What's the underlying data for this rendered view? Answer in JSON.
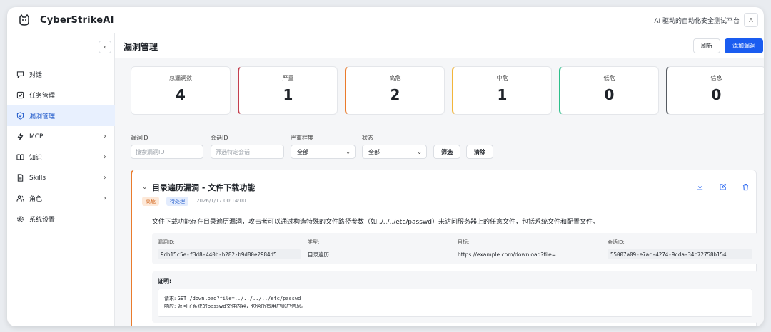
{
  "app": {
    "brand": "CyberStrikeAI",
    "tagline": "AI 驱动的自动化安全测试平台",
    "user_initial": "A"
  },
  "sidebar": {
    "collapse_glyph": "‹",
    "items": [
      {
        "label": "对话",
        "icon": "chat-icon"
      },
      {
        "label": "任务管理",
        "icon": "checkbox-icon"
      },
      {
        "label": "漏洞管理",
        "icon": "shield-icon",
        "active": true
      },
      {
        "label": "MCP",
        "icon": "bolt-icon",
        "has_children": true
      },
      {
        "label": "知识",
        "icon": "book-icon",
        "has_children": true
      },
      {
        "label": "Skills",
        "icon": "document-icon",
        "has_children": true
      },
      {
        "label": "角色",
        "icon": "users-icon",
        "has_children": true
      },
      {
        "label": "系统设置",
        "icon": "gear-icon"
      }
    ]
  },
  "main": {
    "title": "漏洞管理",
    "refresh_label": "刷新",
    "add_label": "添加漏洞"
  },
  "stats": [
    {
      "label": "总漏洞数",
      "value": "4"
    },
    {
      "label": "严重",
      "value": "1"
    },
    {
      "label": "高危",
      "value": "2"
    },
    {
      "label": "中危",
      "value": "1"
    },
    {
      "label": "低危",
      "value": "0"
    },
    {
      "label": "信息",
      "value": "0"
    }
  ],
  "filters": {
    "vuln_id_label": "漏洞ID",
    "vuln_id_placeholder": "搜索漏洞ID",
    "session_id_label": "会话ID",
    "session_id_placeholder": "筛选特定会话",
    "severity_label": "严重程度",
    "severity_value": "全部",
    "status_label": "状态",
    "status_value": "全部",
    "filter_button": "筛选",
    "clear_button": "清除"
  },
  "vulnerability": {
    "title": "目录遍历漏洞 - 文件下载功能",
    "severity_badge": "高危",
    "status_badge": "待处理",
    "time": "2026/1/17 00:14:00",
    "description": "文件下载功能存在目录遍历漏洞，攻击者可以通过构造特殊的文件路径参数（如../../../etc/passwd）来访问服务器上的任意文件，包括系统文件和配置文件。",
    "meta": {
      "id_label": "漏洞ID:",
      "id_value": "9db15c5e-f3d8-440b-b282-b9d80e2984d5",
      "type_label": "类型:",
      "type_value": "目录遍历",
      "target_label": "目标:",
      "target_value": "https://example.com/download?file=",
      "session_label": "会话ID:",
      "session_value": "55007a09-e7ac-4274-9cda-34c72758b154"
    },
    "proof": {
      "title": "证明:",
      "request_label": "请求:",
      "request_value": "GET /download?file=../../../../etc/passwd",
      "response_label": "响应:",
      "response_value": "返回了系统的passwd文件内容，包含所有用户账户信息。"
    }
  },
  "colors": {
    "accent": "#1a5cf0",
    "critical": "#c43f4f",
    "high": "#ea7b2c",
    "medium": "#f2b53a",
    "low": "#2cbf8a",
    "info": "#555a61"
  }
}
